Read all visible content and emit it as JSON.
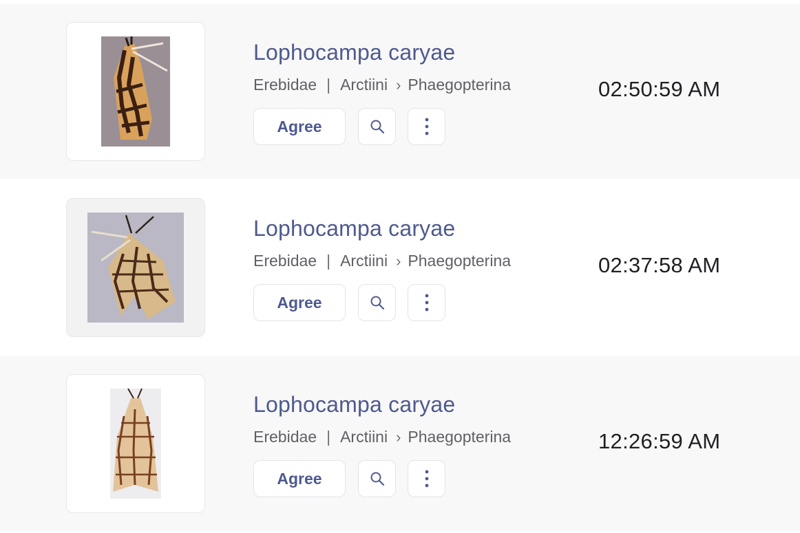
{
  "observations": [
    {
      "name": "Lophocampa caryae",
      "family": "Erebidae",
      "tribe": "Arctiini",
      "subtribe": "Phaegopterina",
      "time": "02:50:59 AM",
      "agree_label": "Agree"
    },
    {
      "name": "Lophocampa caryae",
      "family": "Erebidae",
      "tribe": "Arctiini",
      "subtribe": "Phaegopterina",
      "time": "02:37:58 AM",
      "agree_label": "Agree"
    },
    {
      "name": "Lophocampa caryae",
      "family": "Erebidae",
      "tribe": "Arctiini",
      "subtribe": "Phaegopterina",
      "time": "12:26:59 AM",
      "agree_label": "Agree"
    }
  ],
  "separators": {
    "pipe": "|",
    "chevron": "›"
  },
  "icons": {
    "search": "search-icon",
    "more": "more-vertical-icon"
  },
  "colors": {
    "accent": "#4d5a8f",
    "text_secondary": "#5f5f66",
    "row_shaded": "#f8f8f8"
  }
}
